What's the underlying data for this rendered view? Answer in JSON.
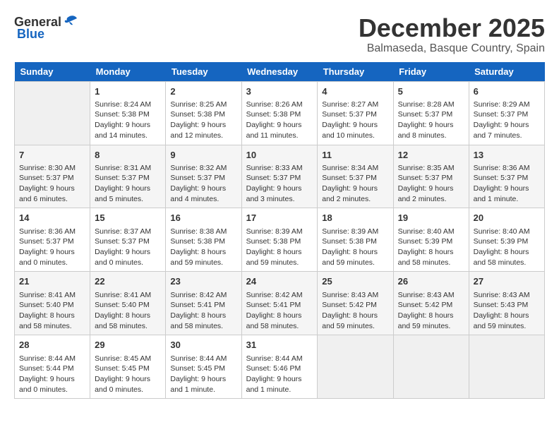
{
  "header": {
    "logo_general": "General",
    "logo_blue": "Blue",
    "month_title": "December 2025",
    "subtitle": "Balmaseda, Basque Country, Spain"
  },
  "days_of_week": [
    "Sunday",
    "Monday",
    "Tuesday",
    "Wednesday",
    "Thursday",
    "Friday",
    "Saturday"
  ],
  "weeks": [
    [
      {
        "day": "",
        "sunrise": "",
        "sunset": "",
        "daylight": ""
      },
      {
        "day": "1",
        "sunrise": "Sunrise: 8:24 AM",
        "sunset": "Sunset: 5:38 PM",
        "daylight": "Daylight: 9 hours and 14 minutes."
      },
      {
        "day": "2",
        "sunrise": "Sunrise: 8:25 AM",
        "sunset": "Sunset: 5:38 PM",
        "daylight": "Daylight: 9 hours and 12 minutes."
      },
      {
        "day": "3",
        "sunrise": "Sunrise: 8:26 AM",
        "sunset": "Sunset: 5:38 PM",
        "daylight": "Daylight: 9 hours and 11 minutes."
      },
      {
        "day": "4",
        "sunrise": "Sunrise: 8:27 AM",
        "sunset": "Sunset: 5:37 PM",
        "daylight": "Daylight: 9 hours and 10 minutes."
      },
      {
        "day": "5",
        "sunrise": "Sunrise: 8:28 AM",
        "sunset": "Sunset: 5:37 PM",
        "daylight": "Daylight: 9 hours and 8 minutes."
      },
      {
        "day": "6",
        "sunrise": "Sunrise: 8:29 AM",
        "sunset": "Sunset: 5:37 PM",
        "daylight": "Daylight: 9 hours and 7 minutes."
      }
    ],
    [
      {
        "day": "7",
        "sunrise": "Sunrise: 8:30 AM",
        "sunset": "Sunset: 5:37 PM",
        "daylight": "Daylight: 9 hours and 6 minutes."
      },
      {
        "day": "8",
        "sunrise": "Sunrise: 8:31 AM",
        "sunset": "Sunset: 5:37 PM",
        "daylight": "Daylight: 9 hours and 5 minutes."
      },
      {
        "day": "9",
        "sunrise": "Sunrise: 8:32 AM",
        "sunset": "Sunset: 5:37 PM",
        "daylight": "Daylight: 9 hours and 4 minutes."
      },
      {
        "day": "10",
        "sunrise": "Sunrise: 8:33 AM",
        "sunset": "Sunset: 5:37 PM",
        "daylight": "Daylight: 9 hours and 3 minutes."
      },
      {
        "day": "11",
        "sunrise": "Sunrise: 8:34 AM",
        "sunset": "Sunset: 5:37 PM",
        "daylight": "Daylight: 9 hours and 2 minutes."
      },
      {
        "day": "12",
        "sunrise": "Sunrise: 8:35 AM",
        "sunset": "Sunset: 5:37 PM",
        "daylight": "Daylight: 9 hours and 2 minutes."
      },
      {
        "day": "13",
        "sunrise": "Sunrise: 8:36 AM",
        "sunset": "Sunset: 5:37 PM",
        "daylight": "Daylight: 9 hours and 1 minute."
      }
    ],
    [
      {
        "day": "14",
        "sunrise": "Sunrise: 8:36 AM",
        "sunset": "Sunset: 5:37 PM",
        "daylight": "Daylight: 9 hours and 0 minutes."
      },
      {
        "day": "15",
        "sunrise": "Sunrise: 8:37 AM",
        "sunset": "Sunset: 5:37 PM",
        "daylight": "Daylight: 9 hours and 0 minutes."
      },
      {
        "day": "16",
        "sunrise": "Sunrise: 8:38 AM",
        "sunset": "Sunset: 5:38 PM",
        "daylight": "Daylight: 8 hours and 59 minutes."
      },
      {
        "day": "17",
        "sunrise": "Sunrise: 8:39 AM",
        "sunset": "Sunset: 5:38 PM",
        "daylight": "Daylight: 8 hours and 59 minutes."
      },
      {
        "day": "18",
        "sunrise": "Sunrise: 8:39 AM",
        "sunset": "Sunset: 5:38 PM",
        "daylight": "Daylight: 8 hours and 59 minutes."
      },
      {
        "day": "19",
        "sunrise": "Sunrise: 8:40 AM",
        "sunset": "Sunset: 5:39 PM",
        "daylight": "Daylight: 8 hours and 58 minutes."
      },
      {
        "day": "20",
        "sunrise": "Sunrise: 8:40 AM",
        "sunset": "Sunset: 5:39 PM",
        "daylight": "Daylight: 8 hours and 58 minutes."
      }
    ],
    [
      {
        "day": "21",
        "sunrise": "Sunrise: 8:41 AM",
        "sunset": "Sunset: 5:40 PM",
        "daylight": "Daylight: 8 hours and 58 minutes."
      },
      {
        "day": "22",
        "sunrise": "Sunrise: 8:41 AM",
        "sunset": "Sunset: 5:40 PM",
        "daylight": "Daylight: 8 hours and 58 minutes."
      },
      {
        "day": "23",
        "sunrise": "Sunrise: 8:42 AM",
        "sunset": "Sunset: 5:41 PM",
        "daylight": "Daylight: 8 hours and 58 minutes."
      },
      {
        "day": "24",
        "sunrise": "Sunrise: 8:42 AM",
        "sunset": "Sunset: 5:41 PM",
        "daylight": "Daylight: 8 hours and 58 minutes."
      },
      {
        "day": "25",
        "sunrise": "Sunrise: 8:43 AM",
        "sunset": "Sunset: 5:42 PM",
        "daylight": "Daylight: 8 hours and 59 minutes."
      },
      {
        "day": "26",
        "sunrise": "Sunrise: 8:43 AM",
        "sunset": "Sunset: 5:42 PM",
        "daylight": "Daylight: 8 hours and 59 minutes."
      },
      {
        "day": "27",
        "sunrise": "Sunrise: 8:43 AM",
        "sunset": "Sunset: 5:43 PM",
        "daylight": "Daylight: 8 hours and 59 minutes."
      }
    ],
    [
      {
        "day": "28",
        "sunrise": "Sunrise: 8:44 AM",
        "sunset": "Sunset: 5:44 PM",
        "daylight": "Daylight: 9 hours and 0 minutes."
      },
      {
        "day": "29",
        "sunrise": "Sunrise: 8:45 AM",
        "sunset": "Sunset: 5:45 PM",
        "daylight": "Daylight: 9 hours and 0 minutes."
      },
      {
        "day": "30",
        "sunrise": "Sunrise: 8:44 AM",
        "sunset": "Sunset: 5:45 PM",
        "daylight": "Daylight: 9 hours and 1 minute."
      },
      {
        "day": "31",
        "sunrise": "Sunrise: 8:44 AM",
        "sunset": "Sunset: 5:46 PM",
        "daylight": "Daylight: 9 hours and 1 minute."
      },
      {
        "day": "",
        "sunrise": "",
        "sunset": "",
        "daylight": ""
      },
      {
        "day": "",
        "sunrise": "",
        "sunset": "",
        "daylight": ""
      },
      {
        "day": "",
        "sunrise": "",
        "sunset": "",
        "daylight": ""
      }
    ]
  ]
}
